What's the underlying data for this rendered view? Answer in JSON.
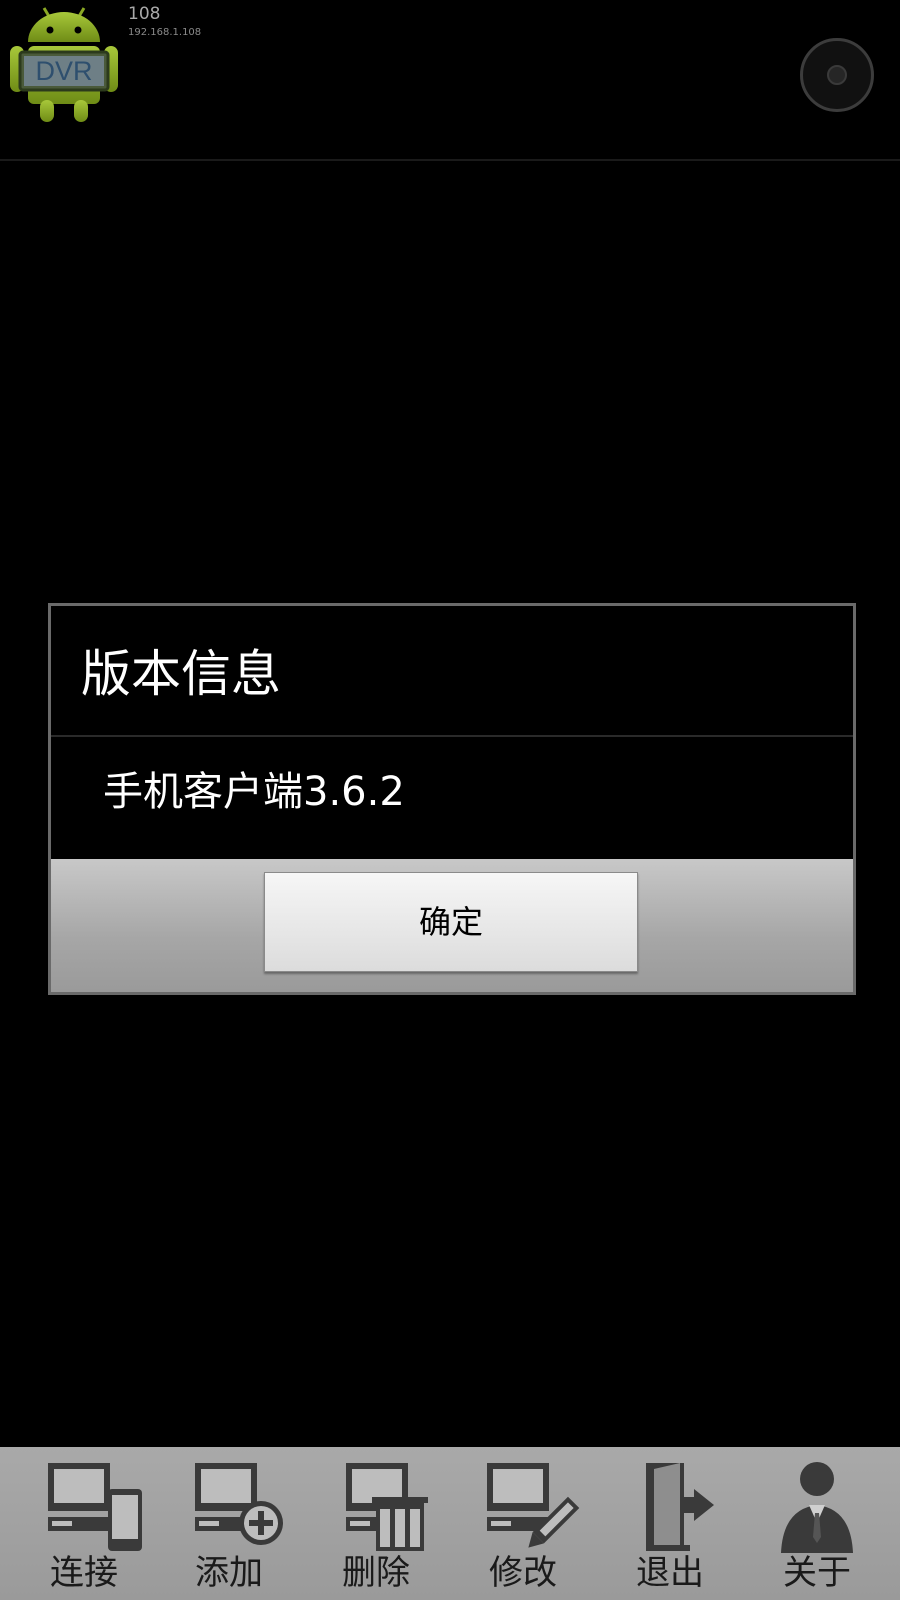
{
  "header": {
    "device_name": "108",
    "device_ip": "192.168.1.108",
    "logo_text": "DVR"
  },
  "dialog": {
    "title": "版本信息",
    "message": "手机客户端3.6.2",
    "confirm_label": "确定"
  },
  "toolbar": {
    "items": [
      {
        "label": "连接",
        "icon": "connect-icon"
      },
      {
        "label": "添加",
        "icon": "add-device-icon"
      },
      {
        "label": "删除",
        "icon": "delete-device-icon"
      },
      {
        "label": "修改",
        "icon": "edit-device-icon"
      },
      {
        "label": "退出",
        "icon": "exit-icon"
      },
      {
        "label": "关于",
        "icon": "about-icon"
      }
    ]
  },
  "colors": {
    "background": "#000000",
    "toolbar": "#a3a3a3",
    "dialog_border": "#6a6a6a",
    "logo_green": "#9bbd2a"
  }
}
